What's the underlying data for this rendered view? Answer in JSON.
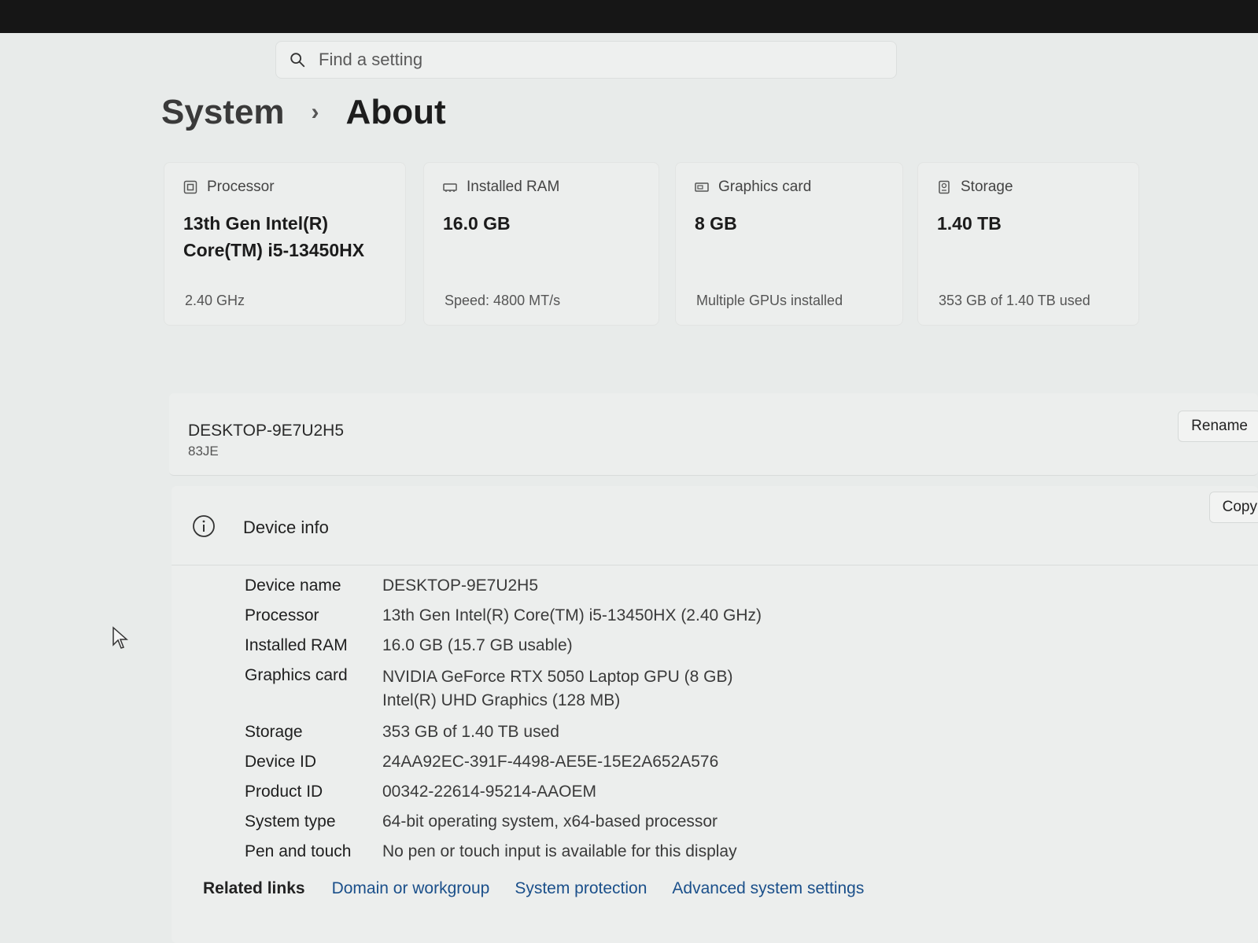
{
  "search": {
    "placeholder": "Find a setting"
  },
  "breadcrumb": {
    "root": "System",
    "separator": "›",
    "current": "About"
  },
  "spec_cards": [
    {
      "icon": "processor-icon",
      "title": "Processor",
      "value": "13th Gen Intel(R) Core(TM) i5-13450HX",
      "sub": "2.40 GHz"
    },
    {
      "icon": "ram-icon",
      "title": "Installed RAM",
      "value": "16.0 GB",
      "sub": "Speed: 4800 MT/s"
    },
    {
      "icon": "graphics-card-icon",
      "title": "Graphics card",
      "value": "8 GB",
      "sub": "Multiple GPUs installed"
    },
    {
      "icon": "storage-icon",
      "title": "Storage",
      "value": "1.40 TB",
      "sub": "353 GB of 1.40 TB used"
    }
  ],
  "device": {
    "name": "DESKTOP-9E7U2H5",
    "model": "83JE",
    "rename_label": "Rename"
  },
  "device_info": {
    "title": "Device info",
    "copy_label": "Copy",
    "rows": [
      {
        "label": "Device name",
        "value": "DESKTOP-9E7U2H5"
      },
      {
        "label": "Processor",
        "value": "13th Gen Intel(R) Core(TM) i5-13450HX (2.40 GHz)"
      },
      {
        "label": "Installed RAM",
        "value": "16.0 GB (15.7 GB usable)"
      },
      {
        "label": "Graphics card",
        "value": "NVIDIA GeForce RTX 5050 Laptop GPU (8 GB)",
        "value2": "Intel(R) UHD Graphics (128 MB)"
      },
      {
        "label": "Storage",
        "value": "353 GB of 1.40 TB used"
      },
      {
        "label": "Device ID",
        "value": "24AA92EC-391F-4498-AE5E-15E2A652A576"
      },
      {
        "label": "Product ID",
        "value": "00342-22614-95214-AAOEM"
      },
      {
        "label": "System type",
        "value": "64-bit operating system, x64-based processor"
      },
      {
        "label": "Pen and touch",
        "value": "No pen or touch input is available for this display"
      }
    ]
  },
  "related_links": {
    "label": "Related links",
    "links": [
      "Domain or workgroup",
      "System protection",
      "Advanced system settings"
    ]
  }
}
